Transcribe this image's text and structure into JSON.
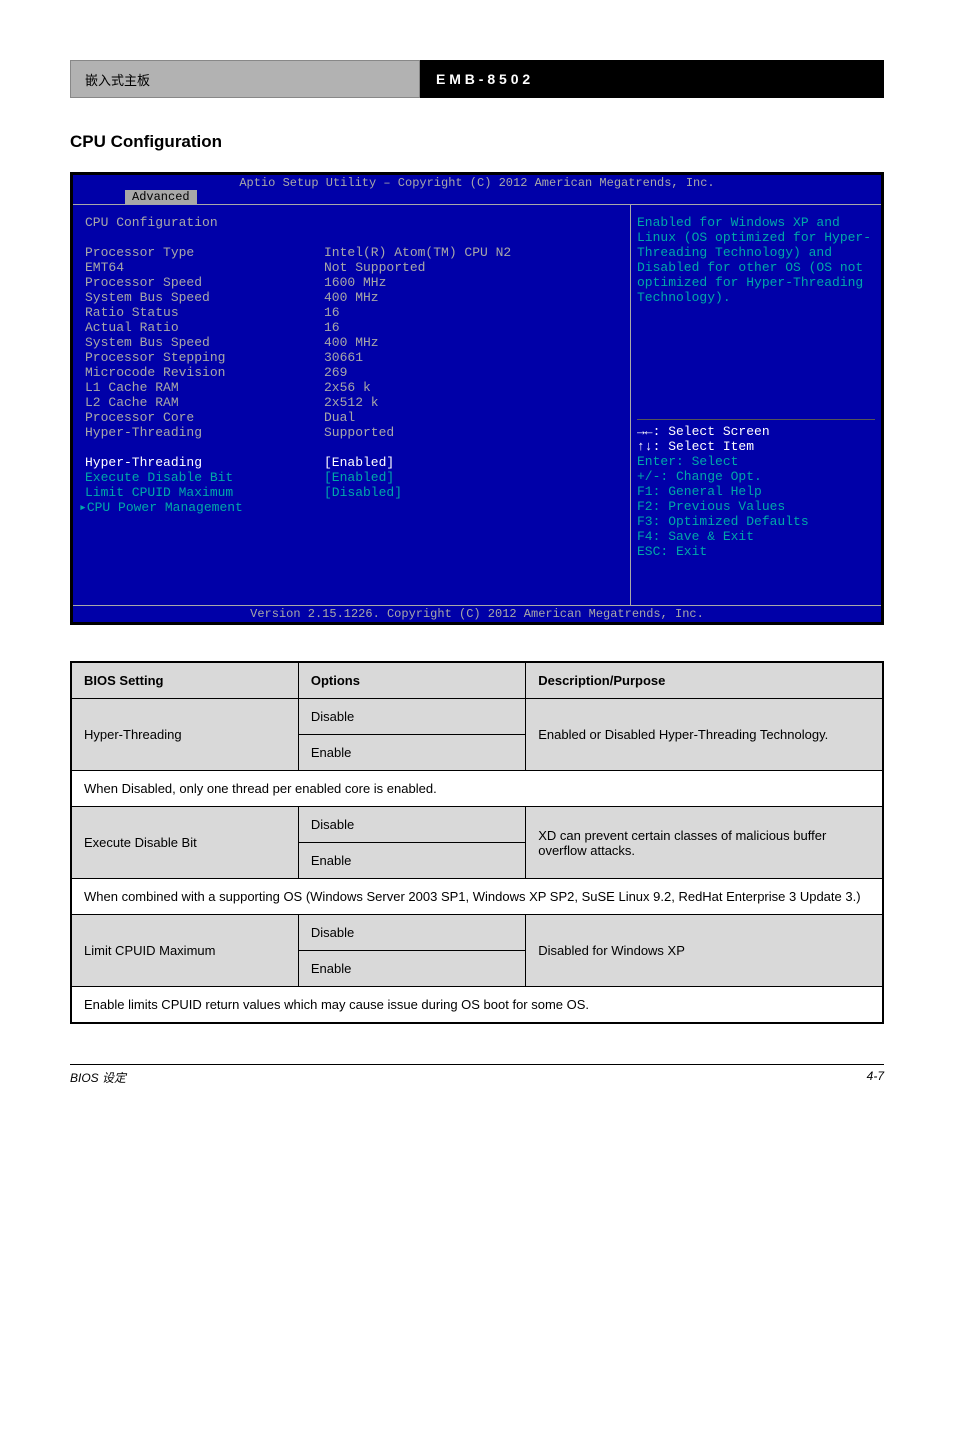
{
  "header": {
    "left_text": "嵌入式主板",
    "right_model": "E M B - 8 5 0 2",
    "right_suffix": ""
  },
  "section_title": "CPU Configuration",
  "bios": {
    "title": "Aptio Setup Utility – Copyright (C) 2012 American Megatrends, Inc.",
    "tab": "Advanced",
    "heading": "CPU Configuration",
    "rows": [
      {
        "label": "Processor Type",
        "value": "Intel(R) Atom(TM) CPU N2"
      },
      {
        "label": "EMT64",
        "value": "Not Supported"
      },
      {
        "label": "Processor Speed",
        "value": "1600 MHz"
      },
      {
        "label": "System Bus Speed",
        "value": "400 MHz"
      },
      {
        "label": "Ratio Status",
        "value": "16"
      },
      {
        "label": "Actual Ratio",
        "value": "16"
      },
      {
        "label": "System Bus Speed",
        "value": "400 MHz"
      },
      {
        "label": "Processor Stepping",
        "value": "30661"
      },
      {
        "label": "Microcode Revision",
        "value": "269"
      },
      {
        "label": "L1 Cache RAM",
        "value": "2x56 k"
      },
      {
        "label": "L2 Cache RAM",
        "value": "2x512 k"
      },
      {
        "label": "Processor Core",
        "value": "Dual"
      },
      {
        "label": "Hyper-Threading",
        "value": "Supported"
      }
    ],
    "options": [
      {
        "label": "Hyper-Threading",
        "value": "[Enabled]",
        "sel": true
      },
      {
        "label": "Execute Disable Bit",
        "value": "[Enabled]",
        "sel": false
      },
      {
        "label": "Limit CPUID Maximum",
        "value": "[Disabled]",
        "sel": false
      }
    ],
    "submenu": "CPU Power Management",
    "help": "Enabled for Windows XP and Linux (OS optimized for Hyper-Threading Technology) and Disabled for other OS (OS not optimized for Hyper-Threading Technology).",
    "keys": [
      "→←: Select Screen",
      "↑↓: Select Item",
      "Enter: Select",
      "+/-: Change Opt.",
      "F1: General Help",
      "F2: Previous Values",
      "F3: Optimized Defaults",
      "F4: Save & Exit",
      "ESC: Exit"
    ],
    "footer": "Version 2.15.1226. Copyright (C) 2012 American Megatrends, Inc."
  },
  "table": {
    "header": {
      "c1": "BIOS Setting",
      "c2": "Options",
      "c3": "Description/Purpose"
    },
    "r1": {
      "name": "Hyper-Threading",
      "opts": [
        "Disable",
        "Enable"
      ],
      "desc": "Enabled or Disabled Hyper-Threading Technology."
    },
    "r1_span": "When Disabled, only one thread per enabled core is enabled.",
    "r2": {
      "name": "Execute Disable Bit",
      "opts": [
        "Disable",
        "Enable"
      ],
      "desc": "XD can prevent certain classes of malicious buffer overflow attacks."
    },
    "r2_span": "When combined with a supporting OS (Windows Server 2003 SP1, Windows XP SP2, SuSE Linux 9.2, RedHat Enterprise 3 Update 3.)",
    "r3": {
      "name": "Limit CPUID Maximum",
      "opts": [
        "Disable",
        "Enable"
      ],
      "desc": "Disabled for Windows XP"
    },
    "r3_span": "Enable limits CPUID return values which may cause issue during OS boot for some OS."
  },
  "footer": {
    "left": "BIOS 设定",
    "right": "4-7"
  }
}
